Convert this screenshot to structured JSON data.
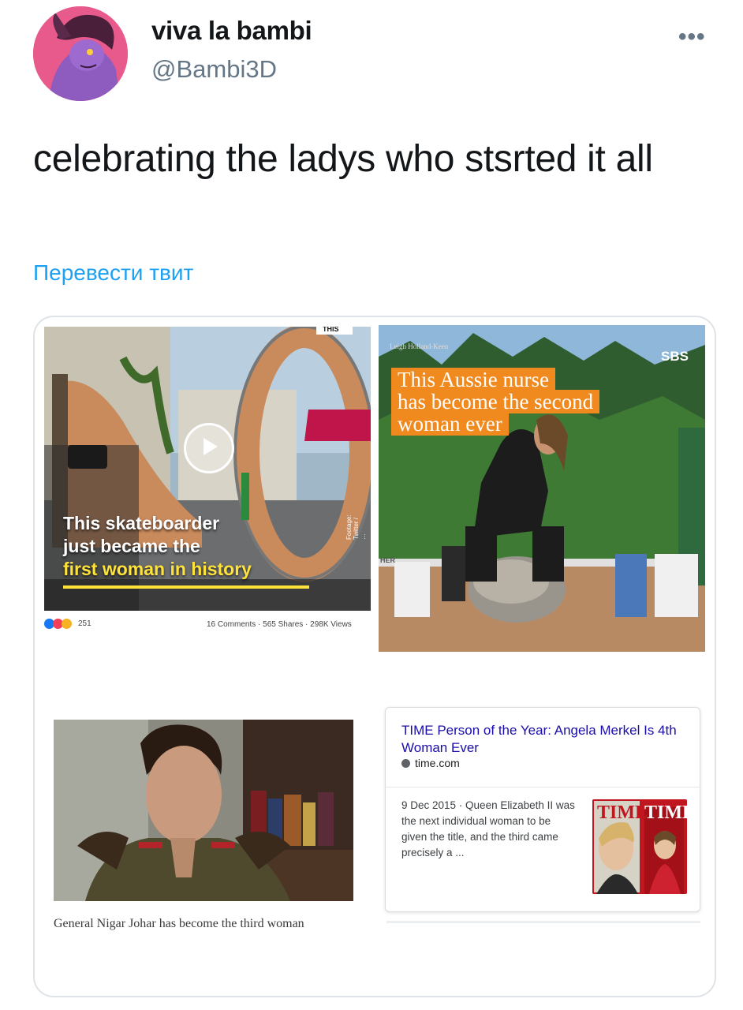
{
  "tweet": {
    "display_name": "viva la bambi",
    "handle": "@Bambi3D",
    "text": "celebrating the ladys who stsrted it all",
    "translate_label": "Перевести твит"
  },
  "media": {
    "skate": {
      "caption_line1": "This skateboarder",
      "caption_line2": "just became the",
      "caption_line3": "first woman in history",
      "sign": "THIS",
      "credit": "Footage: Twitter / …",
      "reactions_count": "251",
      "stats": "16 Comments · 565 Shares · 298K Views"
    },
    "nurse": {
      "credit": "Leigh Holland-Keen",
      "logo": "SBS",
      "caption_line1": "This Aussie nurse",
      "caption_line2": "has become the second",
      "caption_line3": "woman ever",
      "banner": "HER"
    },
    "nigar": {
      "caption": "General Nigar Johar has become the third woman"
    },
    "time": {
      "title": "TIME Person of the Year: Angela Merkel Is 4th Woman Ever",
      "source": "time.com",
      "snippet": "9 Dec 2015 · Queen Elizabeth II was the next individual woman to be given the title, and the third came precisely a ...",
      "cover_text": "TIME"
    }
  }
}
